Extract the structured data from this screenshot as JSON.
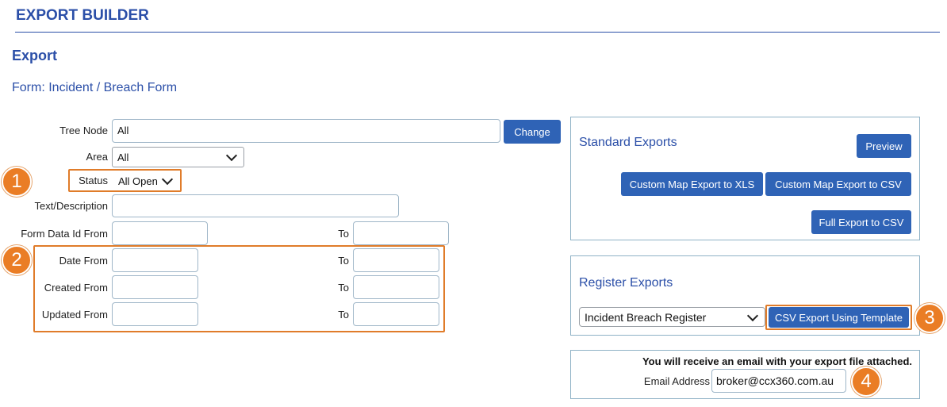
{
  "header": {
    "title": "EXPORT BUILDER"
  },
  "section": {
    "title": "Export"
  },
  "form": {
    "label": "Form: Incident / Breach Form"
  },
  "filters": {
    "tree_node": {
      "label": "Tree Node",
      "value": "All",
      "change_label": "Change"
    },
    "area": {
      "label": "Area",
      "value": "All"
    },
    "status": {
      "label": "Status",
      "value": "All Open"
    },
    "text": {
      "label": "Text/Description",
      "value": ""
    },
    "form_data_id": {
      "label": "Form Data Id From",
      "to_label": "To",
      "from_value": "",
      "to_value": ""
    },
    "date": {
      "label": "Date From",
      "to_label": "To",
      "from_value": "",
      "to_value": ""
    },
    "created": {
      "label": "Created From",
      "to_label": "To",
      "from_value": "",
      "to_value": ""
    },
    "updated": {
      "label": "Updated From",
      "to_label": "To",
      "from_value": "",
      "to_value": ""
    }
  },
  "standard_exports": {
    "title": "Standard Exports",
    "preview_label": "Preview",
    "xls_label": "Custom Map Export to XLS",
    "csv_label": "Custom Map Export to CSV",
    "full_label": "Full Export to CSV"
  },
  "register_exports": {
    "title": "Register Exports",
    "selected": "Incident Breach Register",
    "template_label": "CSV Export Using Template"
  },
  "email": {
    "notice": "You will receive an email with your export file attached.",
    "label": "Email Address",
    "value": "broker@ccx360.com.au"
  },
  "callouts": [
    "1",
    "2",
    "3",
    "4"
  ],
  "colors": {
    "accent": "#2b4fa8",
    "button": "#2f63b6",
    "highlight": "#e07c2a",
    "badge": "#ea7d25"
  }
}
